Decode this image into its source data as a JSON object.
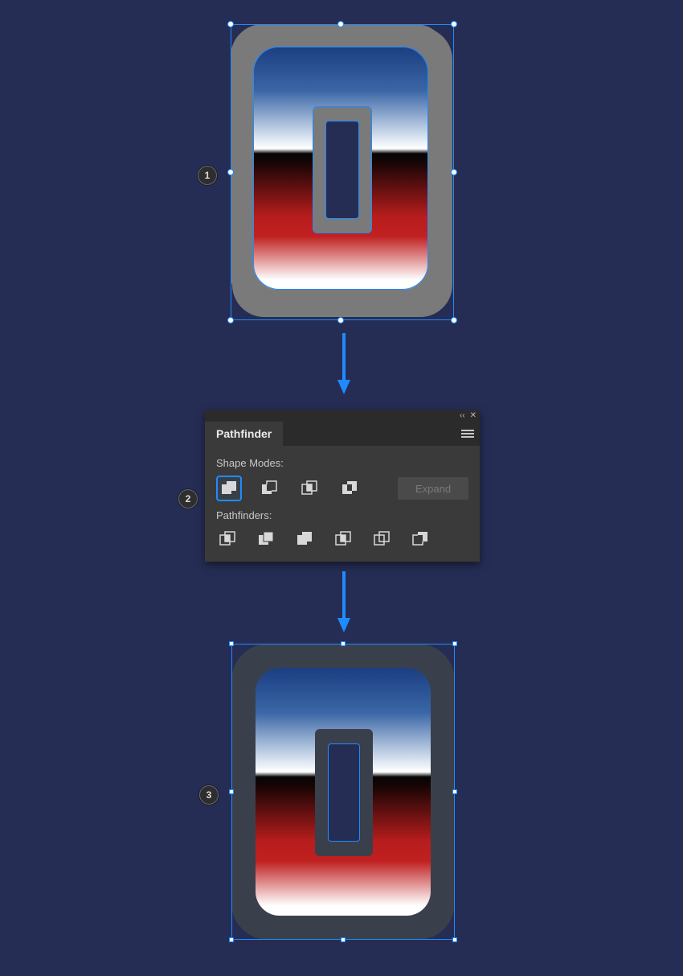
{
  "steps": {
    "1": "1",
    "2": "2",
    "3": "3"
  },
  "panel": {
    "title": "Pathfinder",
    "section_shape_modes": "Shape Modes:",
    "section_pathfinders": "Pathfinders:",
    "expand_label": "Expand",
    "shape_modes": [
      {
        "name": "unite",
        "selected": true
      },
      {
        "name": "minus-front",
        "selected": false
      },
      {
        "name": "intersect",
        "selected": false
      },
      {
        "name": "exclude",
        "selected": false
      }
    ],
    "pathfinders": [
      {
        "name": "divide"
      },
      {
        "name": "trim"
      },
      {
        "name": "merge"
      },
      {
        "name": "crop"
      },
      {
        "name": "outline"
      },
      {
        "name": "minus-back"
      }
    ]
  },
  "colors": {
    "selection": "#1f8bff",
    "panel_bg": "#3a3a3a",
    "canvas_bg": "#262d54"
  }
}
